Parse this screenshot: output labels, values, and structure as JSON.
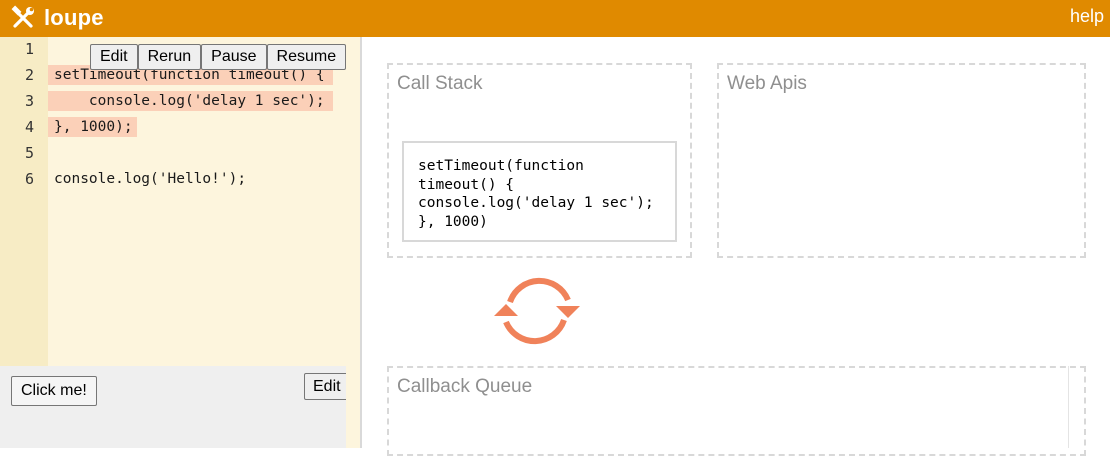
{
  "header": {
    "logo_icon": "hammer-wrench-icon",
    "app_name": "loupe",
    "help_label": "help",
    "color": "#e08a00"
  },
  "editor": {
    "toolbar": {
      "edit": "Edit",
      "rerun": "Rerun",
      "pause": "Pause",
      "resume": "Resume"
    },
    "lines": [
      {
        "num": "1",
        "code": ""
      },
      {
        "num": "2",
        "code": "setTimeout(function timeout() {"
      },
      {
        "num": "3",
        "code": "    console.log('delay 1 sec');"
      },
      {
        "num": "4",
        "code": "}, 1000);"
      },
      {
        "num": "5",
        "code": ""
      },
      {
        "num": "6",
        "code": "console.log('Hello!');"
      }
    ],
    "highlighted_lines": [
      2,
      3,
      4
    ],
    "highlight_color": "#fbd0b8"
  },
  "preview": {
    "click_button": "Click me!",
    "edit_button": "Edit"
  },
  "visualizer": {
    "call_stack_title": "Call Stack",
    "call_stack_frame": "setTimeout(function timeout() { console.log('delay 1 sec'); }, 1000)",
    "web_apis_title": "Web Apis",
    "callback_queue_title": "Callback Queue",
    "event_loop_icon": "refresh-cycle-icon",
    "event_loop_color": "#f0825a"
  }
}
